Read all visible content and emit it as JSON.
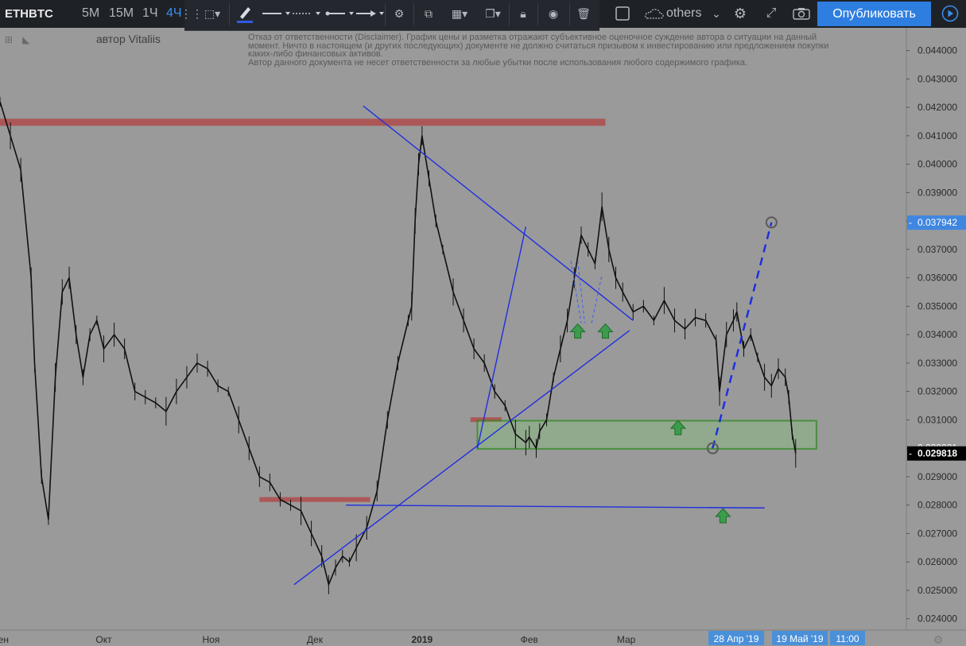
{
  "toolbar": {
    "symbol": "ETHBTC",
    "intervals": [
      "5М",
      "15М",
      "1Ч",
      "4Ч"
    ],
    "active_interval": "4Ч",
    "others_label": "others",
    "publish_label": "Опубликовать",
    "icons": [
      "grip-icon",
      "select-tool-icon",
      "brush-icon",
      "line-style-icon",
      "dash-style-icon",
      "line-dot-icon",
      "arrow-line-icon",
      "gear-icon",
      "magnet-clone-icon",
      "layers-icon",
      "copy-icon",
      "lock-icon",
      "eye-icon",
      "trash-icon",
      "checkbox-icon",
      "cloud-icon",
      "chevron-down-icon",
      "settings-icon",
      "fullscreen-icon",
      "camera-icon",
      "play-icon"
    ]
  },
  "author": "автор Vitaliis",
  "disclaimer": [
    "Отказ от ответственности (Disclaimer). График цены и разметка отражают субъективное оценочное суждение автора о ситуации на данный",
    "момент. Ничто в настоящем (и других последующих) документе не должно считаться призывом к инвестированию или предложением покупки",
    "каких-либо финансовых активов.",
    "Автор данного документа не несет ответственности за любые убытки после использования любого содержимого графика."
  ],
  "chart_data": {
    "type": "line",
    "symbol": "ETHBTC",
    "interval": "4Ч",
    "ylim": [
      0.0236,
      0.0448
    ],
    "y_ticks": [
      "0.044000",
      "0.043000",
      "0.042000",
      "0.041000",
      "0.040000",
      "0.039000",
      "0.038000",
      "0.037000",
      "0.036000",
      "0.035000",
      "0.034000",
      "0.033000",
      "0.032000",
      "0.031000",
      "0.030000",
      "0.029000",
      "0.028000",
      "0.027000",
      "0.026000",
      "0.025000",
      "0.024000"
    ],
    "x_labels": [
      "Сен",
      "Окт",
      "Ноя",
      "Дек",
      "2019",
      "Фев",
      "Мар",
      "Апр"
    ],
    "x_label_days": [
      0,
      30,
      61,
      91,
      122,
      153,
      181,
      212
    ],
    "xlim": [
      0,
      262
    ],
    "cursor_labels": [
      "28 Апр '19",
      "19 Май '19",
      "11:00"
    ],
    "price_labels": [
      {
        "value": 0.037942,
        "text": "0.037942",
        "style": "target"
      },
      {
        "value": 0.030021,
        "text": "0.030021",
        "style": "level"
      },
      {
        "value": 0.029818,
        "text": "0.029818",
        "style": "last"
      }
    ],
    "series": [
      {
        "x": [
          0,
          3,
          6,
          9,
          10,
          12,
          14,
          16,
          18,
          20,
          22,
          24,
          26,
          28,
          30,
          33,
          36,
          39,
          42,
          45,
          48,
          51,
          54,
          57,
          60,
          63,
          66,
          69,
          72,
          75,
          78,
          81,
          84,
          87,
          90,
          93,
          95,
          97,
          99,
          101,
          103,
          106,
          109,
          112,
          115,
          118,
          119,
          120,
          121,
          122,
          124,
          126,
          128,
          131,
          134,
          137,
          140,
          143,
          146,
          149,
          152,
          153,
          155,
          156,
          158,
          160,
          162,
          164,
          166,
          168,
          170,
          172,
          174,
          176,
          178,
          180,
          183,
          186,
          189,
          192,
          195,
          198,
          201,
          204,
          207,
          208,
          210,
          212,
          213,
          215,
          217,
          219,
          221,
          223,
          225,
          227,
          228,
          229,
          230
        ],
        "values": [
          0.0422,
          0.041,
          0.0398,
          0.036,
          0.033,
          0.029,
          0.0275,
          0.0325,
          0.0355,
          0.036,
          0.034,
          0.0325,
          0.034,
          0.0345,
          0.0335,
          0.034,
          0.0335,
          0.032,
          0.0318,
          0.0316,
          0.0313,
          0.032,
          0.0325,
          0.033,
          0.0328,
          0.0322,
          0.032,
          0.031,
          0.03,
          0.029,
          0.0288,
          0.0282,
          0.028,
          0.0278,
          0.027,
          0.0262,
          0.0252,
          0.0258,
          0.0262,
          0.026,
          0.0265,
          0.0272,
          0.0285,
          0.031,
          0.033,
          0.0345,
          0.035,
          0.038,
          0.04,
          0.041,
          0.0395,
          0.038,
          0.037,
          0.0355,
          0.0345,
          0.0335,
          0.033,
          0.032,
          0.0315,
          0.0305,
          0.0302,
          0.0304,
          0.03,
          0.0306,
          0.031,
          0.0325,
          0.0335,
          0.0345,
          0.036,
          0.0375,
          0.037,
          0.0365,
          0.0385,
          0.037,
          0.036,
          0.0355,
          0.0348,
          0.035,
          0.0345,
          0.0352,
          0.0345,
          0.0342,
          0.0346,
          0.0345,
          0.0338,
          0.032,
          0.034,
          0.0345,
          0.0348,
          0.0335,
          0.034,
          0.0332,
          0.0325,
          0.0322,
          0.0328,
          0.0325,
          0.0318,
          0.0305,
          0.02982
        ]
      }
    ],
    "annotations": {
      "resistance_zones": [
        {
          "x0": 0,
          "x1": 175,
          "y0": 0.04135,
          "y1": 0.0416
        },
        {
          "x0": 75,
          "x1": 107,
          "y0": 0.02815,
          "y1": 0.02828
        },
        {
          "x0": 136,
          "x1": 145,
          "y0": 0.03103,
          "y1": 0.03109
        }
      ],
      "support_zone": {
        "x0": 138,
        "x1": 236,
        "y0": 0.02998,
        "y1": 0.03097
      },
      "trend_lines": [
        {
          "x0": 105,
          "y0": 0.04205,
          "x1": 183,
          "y1": 0.0345
        },
        {
          "x0": 85,
          "y0": 0.0252,
          "x1": 182,
          "y1": 0.03415
        },
        {
          "x0": 100,
          "y0": 0.028,
          "x1": 221,
          "y1": 0.0279
        },
        {
          "x0": 138,
          "y0": 0.03,
          "x1": 152,
          "y1": 0.0378
        }
      ],
      "projection": {
        "x0": 206,
        "y0": 0.03,
        "x1": 223,
        "y1": 0.03795
      },
      "dashed_fan": [
        {
          "x0": 165,
          "y0": 0.0366,
          "x1": 168,
          "y1": 0.0344
        },
        {
          "x0": 167,
          "y0": 0.0366,
          "x1": 169,
          "y1": 0.0344
        },
        {
          "x0": 171,
          "y0": 0.0344,
          "x1": 174,
          "y1": 0.0361
        }
      ],
      "circles": [
        {
          "x": 206,
          "y": 0.03
        },
        {
          "x": 223,
          "y": 0.03795
        }
      ],
      "up_arrows": [
        {
          "x": 167,
          "y": 0.0341
        },
        {
          "x": 175,
          "y": 0.0341
        },
        {
          "x": 196,
          "y": 0.0307
        },
        {
          "x": 209,
          "y": 0.0276
        }
      ]
    }
  }
}
